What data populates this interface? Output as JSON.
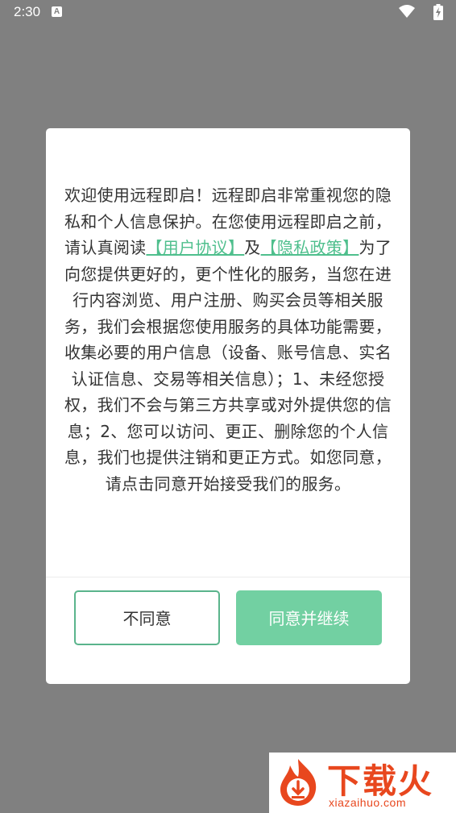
{
  "status_bar": {
    "time": "2:30",
    "notification_icon_letter": "A",
    "icons": [
      "notification-a-icon",
      "wifi-icon",
      "battery-charging-icon"
    ]
  },
  "dialog": {
    "text_before_link1": "欢迎使用远程即启！远程即启非常重视您的隐私和个人信息保护。在您使用远程即启之前，请认真阅读",
    "link_user_agreement": "【用户协议】",
    "text_between_links": "及",
    "link_privacy_policy": "【隐私政策】",
    "text_after_links": "为了向您提供更好的，更个性化的服务，当您在进行内容浏览、用户注册、购买会员等相关服务，我们会根据您使用服务的具体功能需要，收集必要的用户信息（设备、账号信息、实名认证信息、交易等相关信息）；1、未经您授权，我们不会与第三方共享或对外提供您的信息；2、您可以访问、更正、删除您的个人信息，我们也提供注销和更正方式。如您同意，请点击同意开始接受我们的服务。",
    "disagree_label": "不同意",
    "agree_label": "同意并继续"
  },
  "watermark": {
    "title": "下载火",
    "url": "xiazaihuo.com"
  },
  "colors": {
    "backdrop": "#808080",
    "accent_green": "#4fbf8d",
    "agree_button": "#72d0a2",
    "watermark_orange": "#e8471e"
  }
}
